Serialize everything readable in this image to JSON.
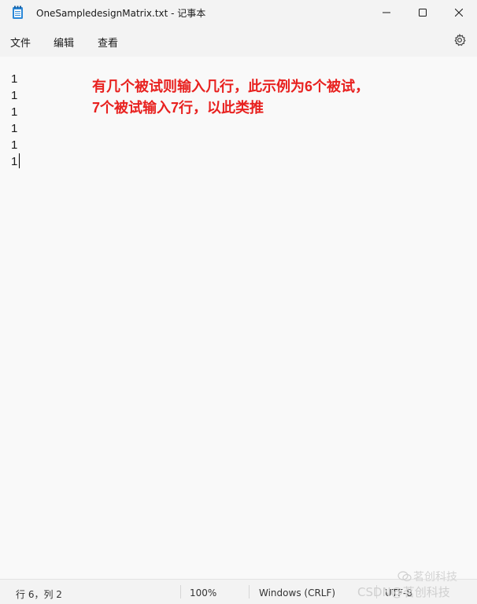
{
  "window": {
    "title": "OneSampledesignMatrix.txt - 记事本"
  },
  "menu": {
    "items": [
      "文件",
      "编辑",
      "查看"
    ]
  },
  "icons": {
    "app": "notepad-icon",
    "minimize": "minimize-icon",
    "maximize": "maximize-icon",
    "close": "close-icon",
    "settings": "gear-icon"
  },
  "editor": {
    "lines": [
      "1",
      "1",
      "1",
      "1",
      "1",
      "1"
    ],
    "annotation": {
      "line1": "有几个被试则输入几行，此示例为6个被试，",
      "line2": "7个被试输入7行，以此类推",
      "color": "#e8211f"
    }
  },
  "status": {
    "position": "行 6，列 2",
    "zoom": "100%",
    "line_ending": "Windows (CRLF)",
    "encoding": "UTF-8"
  },
  "watermark": {
    "csdn": "CSDN",
    "brand": "@茗创科技",
    "wechat": "茗创科技"
  }
}
